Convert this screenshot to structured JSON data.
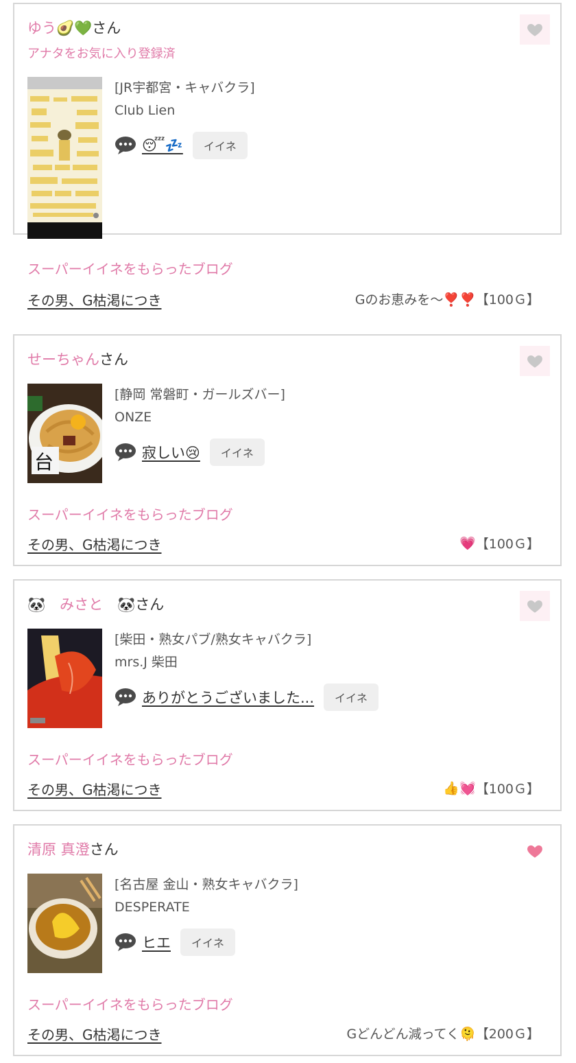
{
  "posts": [
    {
      "user_name": "ゆう🥑💚",
      "honorific": "さん",
      "fav_note": "アナタをお気に入り登録済",
      "shop_category": "[JR宇都宮・キャバクラ]",
      "shop_name": "Club Lien",
      "comment": "😴💤",
      "iine_label": "イイネ",
      "super_label": "スーパーイイネをもらったブログ",
      "blog_title": "その男、G枯渇につき",
      "reward_text": "Gのお恵みを〜❣️❣️",
      "reward_amount": "【100Ｇ】",
      "liked": false,
      "heart_color": "#c8c8c8"
    },
    {
      "user_name": "せーちゃん",
      "honorific": "さん",
      "shop_category": "[静岡 常磐町・ガールズバー]",
      "shop_name": "ONZE",
      "comment": "寂しい😢",
      "iine_label": "イイネ",
      "super_label": "スーパーイイネをもらったブログ",
      "blog_title": "その男、G枯渇につき",
      "reward_text": "💗",
      "reward_amount": "【100Ｇ】",
      "liked": false,
      "heart_color": "#c8c8c8"
    },
    {
      "user_name": "🐼　みさと　🐼",
      "honorific": "さん",
      "shop_category": "[柴田・熟女パブ/熟女キャバクラ]",
      "shop_name": "mrs.J 柴田",
      "comment": "ありがとうございました...",
      "iine_label": "イイネ",
      "super_label": "スーパーイイネをもらったブログ",
      "blog_title": "その男、G枯渇につき",
      "reward_text": "👍💓",
      "reward_amount": "【100Ｇ】",
      "liked": false,
      "heart_color": "#c8c8c8"
    },
    {
      "user_name": "清原 真澄",
      "honorific": "さん",
      "shop_category": "[名古屋 金山・熟女キャバクラ]",
      "shop_name": "DESPERATE",
      "comment": "ヒエ",
      "iine_label": "イイネ",
      "super_label": "スーパーイイネをもらったブログ",
      "blog_title": "その男、G枯渇につき",
      "reward_text": "Gどんどん減ってく🫠",
      "reward_amount": "【200Ｇ】",
      "liked": true,
      "heart_color": "#ee7898"
    }
  ]
}
